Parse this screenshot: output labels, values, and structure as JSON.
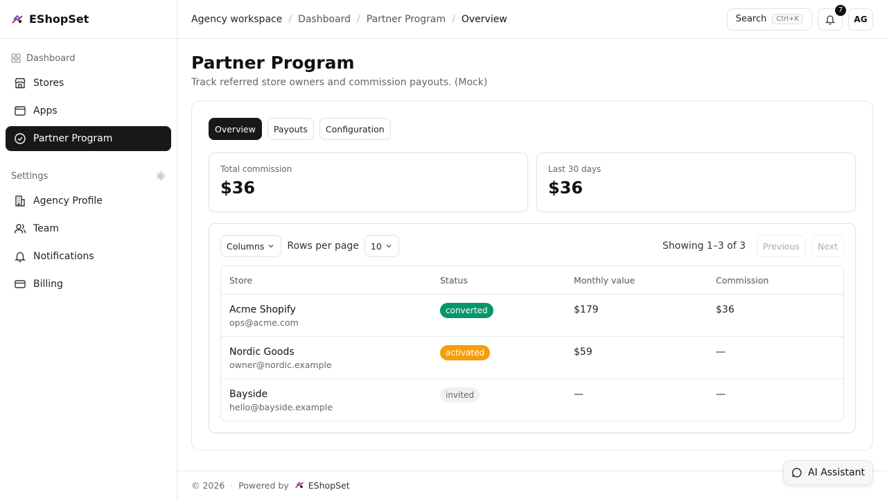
{
  "app": {
    "name": "EShopSet"
  },
  "sidebar": {
    "section_label": "Dashboard",
    "items": [
      {
        "label": "Stores",
        "icon": "store-icon"
      },
      {
        "label": "Apps",
        "icon": "apps-icon"
      },
      {
        "label": "Partner Program",
        "icon": "badge-check-icon",
        "active": true
      }
    ],
    "settings_label": "Settings",
    "settings_items": [
      {
        "label": "Agency Profile",
        "icon": "building-icon"
      },
      {
        "label": "Team",
        "icon": "users-icon"
      },
      {
        "label": "Notifications",
        "icon": "bell-icon"
      },
      {
        "label": "Billing",
        "icon": "credit-card-icon"
      }
    ]
  },
  "topbar": {
    "breadcrumbs": [
      "Agency workspace",
      "Dashboard",
      "Partner Program",
      "Overview"
    ],
    "search_label": "Search",
    "search_shortcut": "Ctrl+K",
    "notification_count": "7",
    "avatar_initials": "AG"
  },
  "page": {
    "title": "Partner Program",
    "subtitle": "Track referred store owners and commission payouts. (Mock)"
  },
  "tabs": [
    {
      "label": "Overview",
      "active": true
    },
    {
      "label": "Payouts"
    },
    {
      "label": "Configuration"
    }
  ],
  "stats": [
    {
      "label": "Total commission",
      "value": "$36"
    },
    {
      "label": "Last 30 days",
      "value": "$36"
    }
  ],
  "table": {
    "columns_button": "Columns",
    "rows_per_page_label": "Rows per page",
    "rows_per_page_value": "10",
    "showing": "Showing 1–3 of 3",
    "previous": "Previous",
    "next": "Next",
    "headers": [
      "Store",
      "Status",
      "Monthly value",
      "Commission"
    ],
    "rows": [
      {
        "store": "Acme Shopify",
        "email": "ops@acme.com",
        "status": "converted",
        "monthly": "$179",
        "commission": "$36"
      },
      {
        "store": "Nordic Goods",
        "email": "owner@nordic.example",
        "status": "activated",
        "monthly": "$59",
        "commission": "—"
      },
      {
        "store": "Bayside",
        "email": "hello@bayside.example",
        "status": "invited",
        "monthly": "—",
        "commission": "—"
      }
    ]
  },
  "footer": {
    "copyright": "© 2026",
    "powered_by": "Powered by",
    "brand": "EShopSet"
  },
  "assistant": {
    "label": "AI Assistant"
  },
  "colors": {
    "active_bg": "#18181b",
    "converted": "#059669",
    "activated": "#f59e0b",
    "invited": "#f1f1f1"
  }
}
